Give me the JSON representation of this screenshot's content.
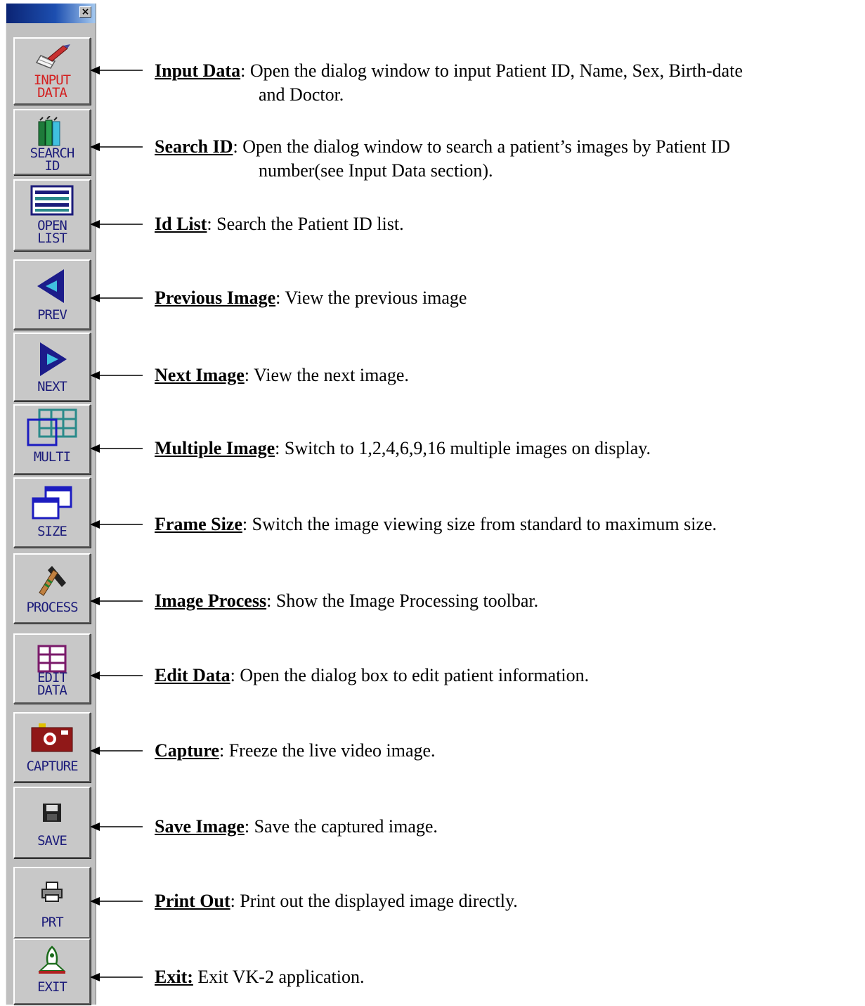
{
  "toolbar": {
    "close_glyph": "×",
    "buttons": [
      {
        "label": "INPUT\nDATA",
        "icon": "pen-icon"
      },
      {
        "label": "SEARCH\nID",
        "icon": "books-icon"
      },
      {
        "label": "OPEN\nLIST",
        "icon": "list-icon"
      },
      {
        "label": "PREV",
        "icon": "left-triangle-icon"
      },
      {
        "label": "NEXT",
        "icon": "right-triangle-icon"
      },
      {
        "label": "MULTI",
        "icon": "grid-icon"
      },
      {
        "label": "SIZE",
        "icon": "windows-icon"
      },
      {
        "label": "PROCESS",
        "icon": "hammer-icon"
      },
      {
        "label": "EDIT\nDATA",
        "icon": "edit-grid-icon"
      },
      {
        "label": "CAPTURE",
        "icon": "camera-icon"
      },
      {
        "label": "SAVE",
        "icon": "floppy-icon"
      },
      {
        "label": "PRT",
        "icon": "printer-icon"
      },
      {
        "label": "EXIT",
        "icon": "rocket-icon"
      }
    ]
  },
  "descriptions": [
    {
      "term": "Input Data",
      "sep": ":",
      "line1": " Open the dialog window to input Patient ID, Name, Sex, Birth-date",
      "line2": "and Doctor."
    },
    {
      "term": "Search ID",
      "sep": ":",
      "line1": "  Open the dialog window to search a patient’s images by Patient ID",
      "line2": "number(see Input Data section)."
    },
    {
      "term": "Id List",
      "sep": ":",
      "line1": " Search the Patient ID list.",
      "line2": ""
    },
    {
      "term": "Previous Image",
      "sep": ":",
      "line1": " View the previous image",
      "line2": ""
    },
    {
      "term": "Next Image",
      "sep": ":",
      "line1": "  View the next image.",
      "line2": ""
    },
    {
      "term": "Multiple Image",
      "sep": ":",
      "line1": " Switch to 1,2,4,6,9,16 multiple images on display.",
      "line2": ""
    },
    {
      "term": "Frame Size",
      "sep": ":",
      "line1": " Switch the image viewing size from standard to maximum size.",
      "line2": ""
    },
    {
      "term": "Image Process",
      "sep": ":",
      "line1": " Show the Image Processing toolbar.",
      "line2": ""
    },
    {
      "term": "Edit Data",
      "sep": ":",
      "line1": " Open the dialog box to edit patient information.",
      "line2": ""
    },
    {
      "term": "Capture",
      "sep": ":",
      "line1": " Freeze the live video image.",
      "line2": ""
    },
    {
      "term": "Save Image",
      "sep": ":",
      "line1": " Save the captured image.",
      "line2": ""
    },
    {
      "term": "Print Out",
      "sep": ":",
      "line1": " Print out the displayed image directly.",
      "line2": ""
    },
    {
      "term": "Exit:",
      "sep": "",
      "line1": "  Exit VK-2 application.",
      "line2": ""
    }
  ],
  "colors": {
    "title_bar_dark": "#0b2474",
    "title_bar_light": "#a6caf0",
    "toolbar_face": "#c0c0c0",
    "label_blue": "#1c1c7a",
    "label_red": "#d32020"
  }
}
